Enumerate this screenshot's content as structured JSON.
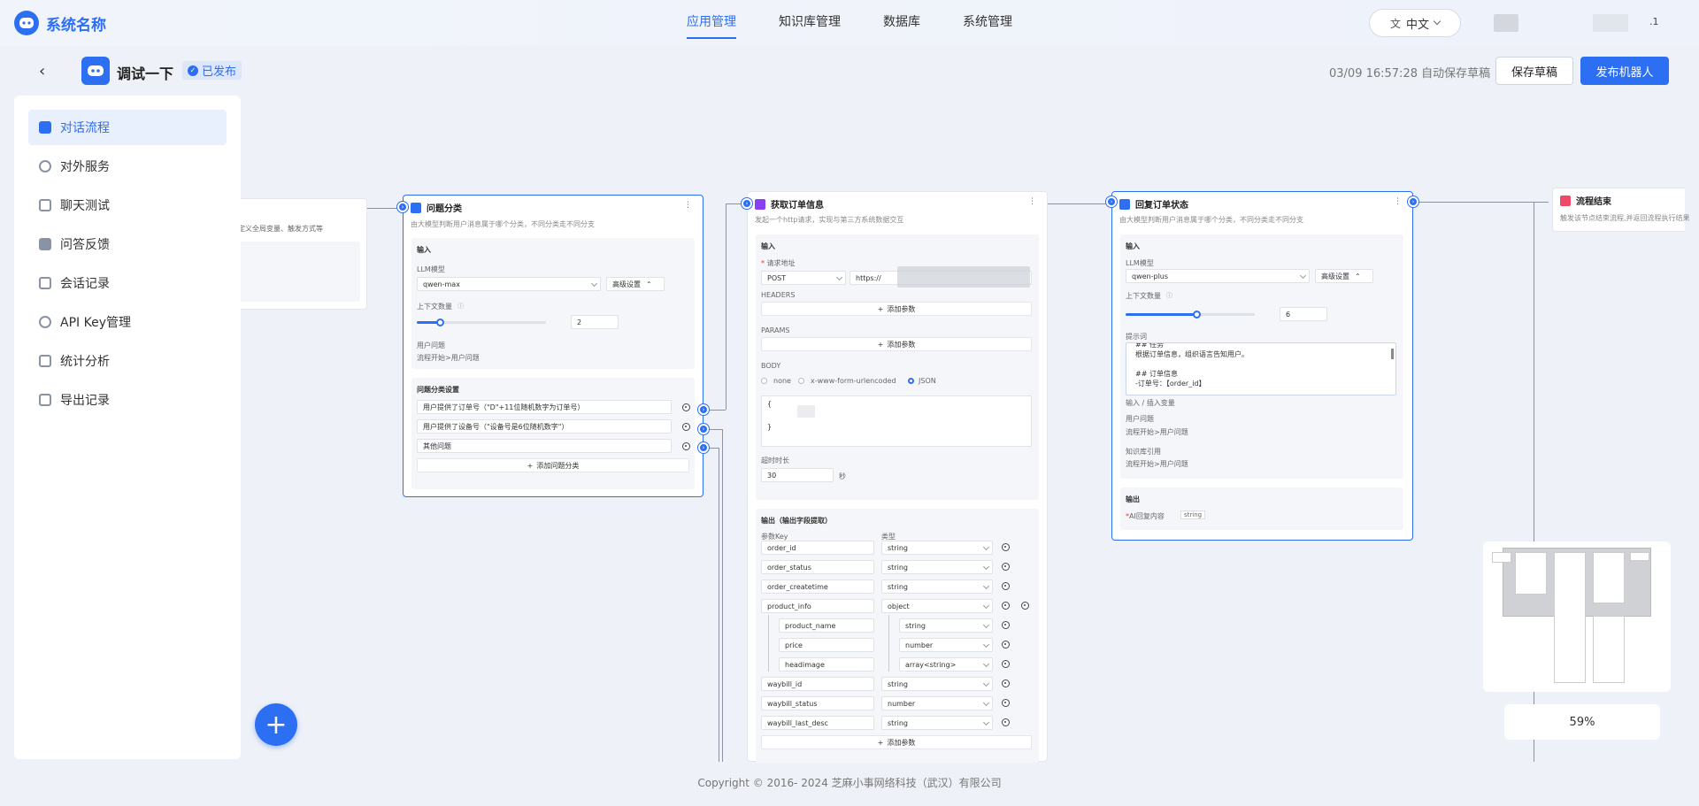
{
  "app": {
    "name": "系统名称"
  },
  "nav": [
    {
      "label": "应用管理",
      "active": true
    },
    {
      "label": "知识库管理",
      "active": false
    },
    {
      "label": "数据库",
      "active": false
    },
    {
      "label": "系统管理",
      "active": false
    }
  ],
  "lang": {
    "label": "中文"
  },
  "user": {
    "suffix": ".1"
  },
  "header": {
    "title": "调试一下",
    "status": "已发布",
    "autosave": "03/09 16:57:28 自动保存草稿",
    "save_draft": "保存草稿",
    "publish": "发布机器人"
  },
  "sidebar": {
    "items": [
      {
        "label": "对话流程",
        "icon": "flow-icon",
        "active": true
      },
      {
        "label": "对外服务",
        "icon": "service-icon",
        "active": false
      },
      {
        "label": "聊天测试",
        "icon": "chat-test-icon",
        "active": false
      },
      {
        "label": "问答反馈",
        "icon": "feedback-icon",
        "active": false
      },
      {
        "label": "会话记录",
        "icon": "record-icon",
        "active": false
      },
      {
        "label": "API Key管理",
        "icon": "key-icon",
        "active": false
      },
      {
        "label": "统计分析",
        "icon": "chart-icon",
        "active": false
      },
      {
        "label": "导出记录",
        "icon": "export-icon",
        "active": false
      }
    ]
  },
  "nodes": {
    "start": {
      "desc": "定义全局变量、触发方式等"
    },
    "classify": {
      "title": "问题分类",
      "desc": "由大模型判断用户消息属于哪个分类，不同分类走不同分支",
      "input_label": "输入",
      "llm_label": "LLM模型",
      "llm_value": "qwen-max",
      "adv": "高级设置",
      "ctx_label": "上下文数量",
      "ctx_value": "2",
      "ctx_fraction": 0.18,
      "question_label": "用户问题",
      "question_value": "流程开始>用户问题",
      "settings_label": "问题分类设置",
      "categories": [
        "用户提供了订单号（\"D\"+11位随机数字为订单号）",
        "用户提供了设备号（\"设备号是6位随机数字\"）",
        "其他问题"
      ],
      "add_label": "添加问题分类"
    },
    "order": {
      "title": "获取订单信息",
      "desc": "发起一个http请求，实现与第三方系统数据交互",
      "input_label": "输入",
      "url_label": "请求地址",
      "method": "POST",
      "url_prefix": "https://",
      "headers_label": "HEADERS",
      "params_label": "PARAMS",
      "add_param": "添加参数",
      "body_label": "BODY",
      "body_options": [
        "none",
        "x-www-form-urlencoded",
        "JSON"
      ],
      "body_open": "{",
      "body_close": "}",
      "timeout_label": "超时时长",
      "timeout_value": "30",
      "timeout_unit": "秒",
      "output_label": "输出（输出字段提取）",
      "key_header": "参数Key",
      "type_header": "类型",
      "fields": [
        {
          "key": "order_id",
          "type": "string"
        },
        {
          "key": "order_status",
          "type": "string"
        },
        {
          "key": "order_createtime",
          "type": "string"
        },
        {
          "key": "product_info",
          "type": "object"
        },
        {
          "key": "product_name",
          "type": "string"
        },
        {
          "key": "price",
          "type": "number"
        },
        {
          "key": "headimage",
          "type": "array<string>"
        },
        {
          "key": "waybill_id",
          "type": "string"
        },
        {
          "key": "waybill_status",
          "type": "number"
        },
        {
          "key": "waybill_last_desc",
          "type": "string"
        }
      ]
    },
    "reply": {
      "title": "回复订单状态",
      "desc": "由大模型判断用户消息属于哪个分类，不同分类走不同分支",
      "input_label": "输入",
      "llm_label": "LLM模型",
      "llm_value": "qwen-plus",
      "adv": "高级设置",
      "ctx_label": "上下文数量",
      "ctx_value": "6",
      "ctx_fraction": 0.55,
      "prompt_label": "提示词",
      "prompt_lines": [
        "## 任务",
        "根据订单信息，组织语言告知用户。",
        "",
        "## 订单信息",
        "-订单号：【order_id】"
      ],
      "prompt_hint": "输入 / 插入变量",
      "question_label": "用户问题",
      "question_value": "流程开始>用户问题",
      "kb_label": "知识库引用",
      "kb_value": "流程开始>用户问题",
      "output_label": "输出",
      "output_field": "AI回复内容",
      "output_type": "string"
    },
    "end": {
      "title": "流程结束",
      "desc": "触发该节点结束流程,并返回流程执行结果"
    }
  },
  "zoom": "59%",
  "footer": "Copyright © 2016- 2024 芝麻小事网络科技（武汉）有限公司"
}
